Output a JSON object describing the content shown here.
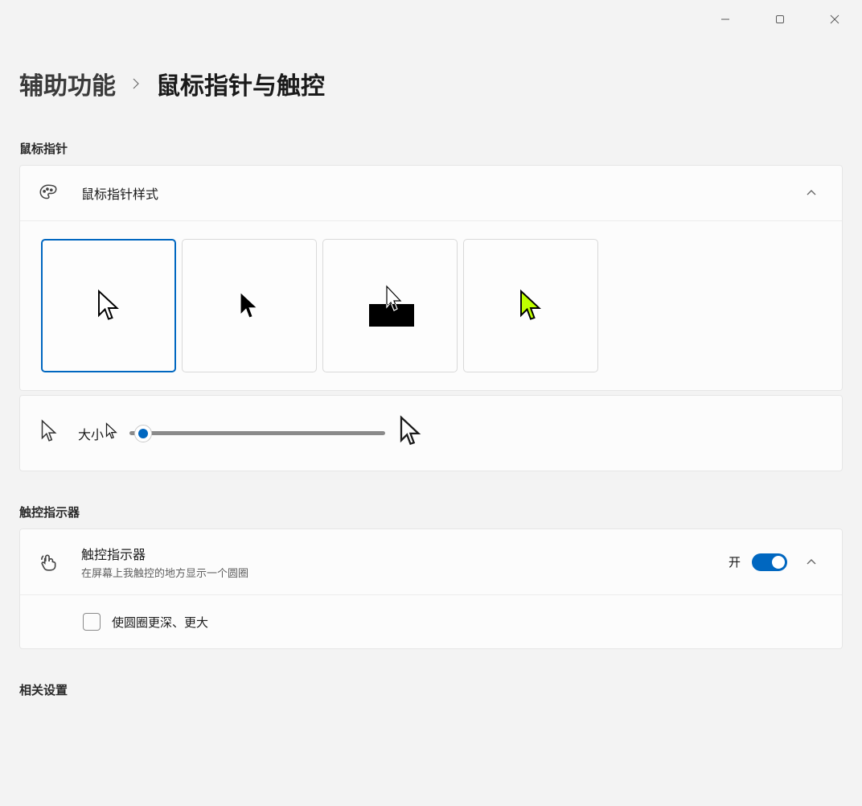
{
  "breadcrumb": {
    "parent": "辅助功能",
    "current": "鼠标指针与触控"
  },
  "sections": {
    "pointer_section_title": "鼠标指针",
    "touch_section_title": "触控指示器",
    "related_section_title": "相关设置"
  },
  "pointer_style": {
    "row_title": "鼠标指针样式",
    "expanded": true,
    "selected_index": 0
  },
  "pointer_size": {
    "label": "大小"
  },
  "touch_indicator": {
    "title": "触控指示器",
    "subtitle": "在屏幕上我触控的地方显示一个圆圈",
    "state_text": "开",
    "on": true,
    "option_label": "使圆圈更深、更大",
    "option_checked": false
  }
}
